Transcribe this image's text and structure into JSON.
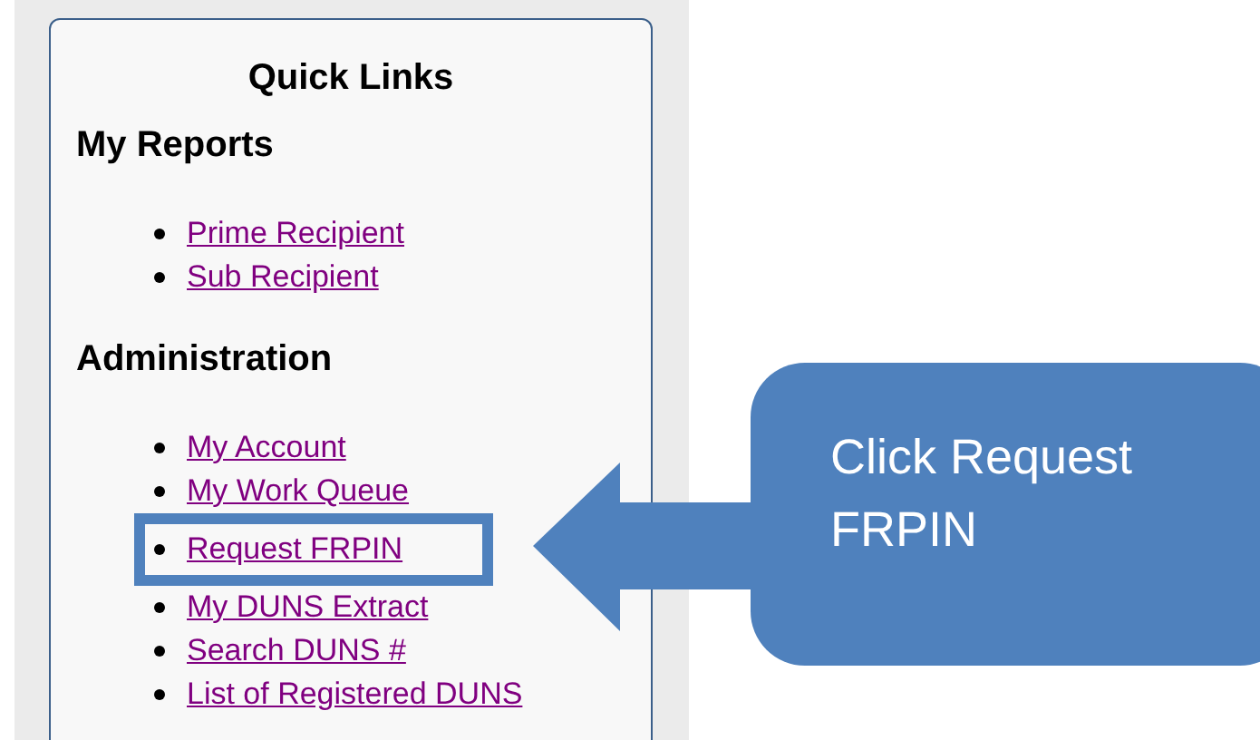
{
  "quick_links": {
    "title": "Quick Links",
    "sections": [
      {
        "heading": "My Reports",
        "links": [
          {
            "label": "Prime Recipient",
            "highlighted": false
          },
          {
            "label": "Sub Recipient",
            "highlighted": false
          }
        ]
      },
      {
        "heading": "Administration",
        "links": [
          {
            "label": "My Account",
            "highlighted": false
          },
          {
            "label": "My Work Queue",
            "highlighted": false
          },
          {
            "label": "Request FRPIN",
            "highlighted": true
          },
          {
            "label": "My DUNS Extract",
            "highlighted": false
          },
          {
            "label": "Search DUNS #",
            "highlighted": false
          },
          {
            "label": "List of Registered DUNS",
            "highlighted": false
          }
        ]
      }
    ]
  },
  "callout": {
    "text": "Click Request FRPIN"
  }
}
